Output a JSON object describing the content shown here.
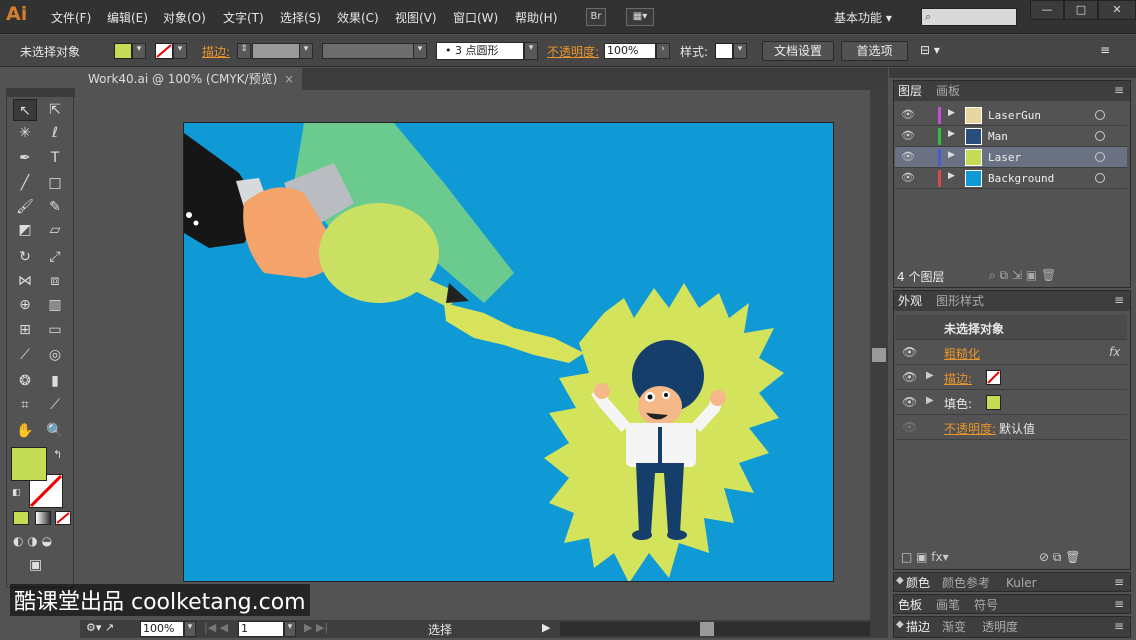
{
  "app": {
    "logo": "Ai"
  },
  "menu": [
    "文件(F)",
    "编辑(E)",
    "对象(O)",
    "文字(T)",
    "选择(S)",
    "效果(C)",
    "视图(V)",
    "窗口(W)",
    "帮助(H)"
  ],
  "titlebar": {
    "bridge": "Br",
    "workspace": "基本功能"
  },
  "control": {
    "selection": "未选择对象",
    "stroke_label": "描边:",
    "brush": "3 点圆形",
    "opacity_label": "不透明度:",
    "opacity_value": "100%",
    "style_label": "样式:",
    "doc_settings": "文档设置",
    "preferences": "首选项"
  },
  "document": {
    "tab": "Work40.ai @ 100% (CMYK/预览)"
  },
  "status": {
    "zoom": "100%",
    "artboard": "1",
    "tool": "选择"
  },
  "layers_panel": {
    "tabs": [
      "图层",
      "画板"
    ],
    "layers": [
      {
        "name": "LaserGun",
        "color": "#c44fd6"
      },
      {
        "name": "Man",
        "color": "#2fbf3b"
      },
      {
        "name": "Laser",
        "color": "#4a5bd6"
      },
      {
        "name": "Background",
        "color": "#d64a4a"
      }
    ],
    "count": "4 个图层"
  },
  "appearance_panel": {
    "tabs": [
      "外观",
      "图形样式"
    ],
    "header": "未选择对象",
    "effect": "粗糙化",
    "stroke": "描边:",
    "fill": "填色:",
    "opacity": "不透明度:",
    "opacity_value": "默认值"
  },
  "color_panels": {
    "row1": [
      "颜色",
      "颜色参考",
      "Kuler"
    ],
    "row2": [
      "色板",
      "画笔",
      "符号"
    ],
    "row3": [
      "描边",
      "渐变",
      "透明度"
    ]
  },
  "watermark": "酷课堂出品 coolketang.com",
  "colors": {
    "fill": "#c5dc55",
    "artboard": "#0f9ad6",
    "accent": "#e8952b"
  }
}
